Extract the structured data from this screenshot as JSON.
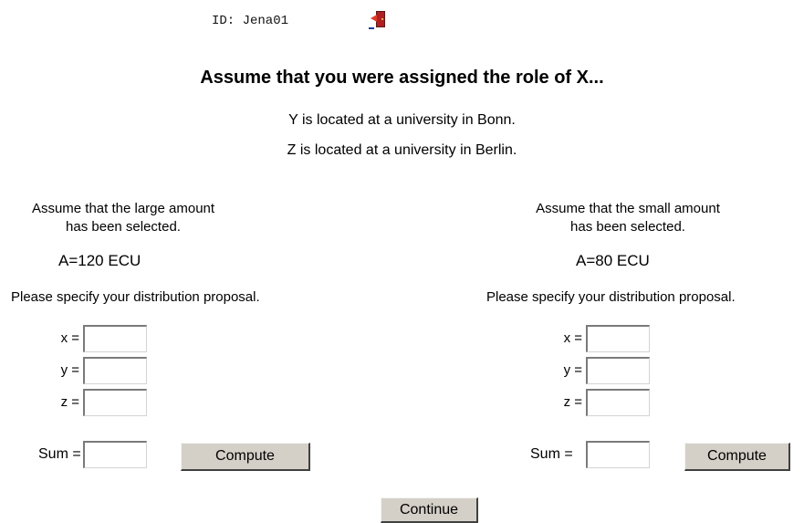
{
  "header": {
    "id_label": "ID: Jena01"
  },
  "headline": "Assume that you were assigned the role of X...",
  "info": {
    "line1": "Y is located at a university in Bonn.",
    "line2": "Z is located at a university in Berlin."
  },
  "left": {
    "assume_line1": "Assume that the large amount",
    "assume_line2": "has been selected.",
    "amount": "A=120 ECU",
    "prompt": "Please specify your distribution proposal.",
    "x_label": "x =",
    "y_label": "y =",
    "z_label": "z =",
    "x_value": "",
    "y_value": "",
    "z_value": "",
    "sum_label": "Sum =",
    "sum_value": "",
    "compute_label": "Compute"
  },
  "right": {
    "assume_line1": "Assume that the small amount",
    "assume_line2": "has been selected.",
    "amount": "A=80 ECU",
    "prompt": "Please specify your distribution proposal.",
    "x_label": "x =",
    "y_label": "y =",
    "z_label": "z =",
    "x_value": "",
    "y_value": "",
    "z_value": "",
    "sum_label": "Sum =",
    "sum_value": "",
    "compute_label": "Compute"
  },
  "footer": {
    "continue_label": "Continue"
  },
  "icons": {
    "exit": "exit-door-icon"
  }
}
